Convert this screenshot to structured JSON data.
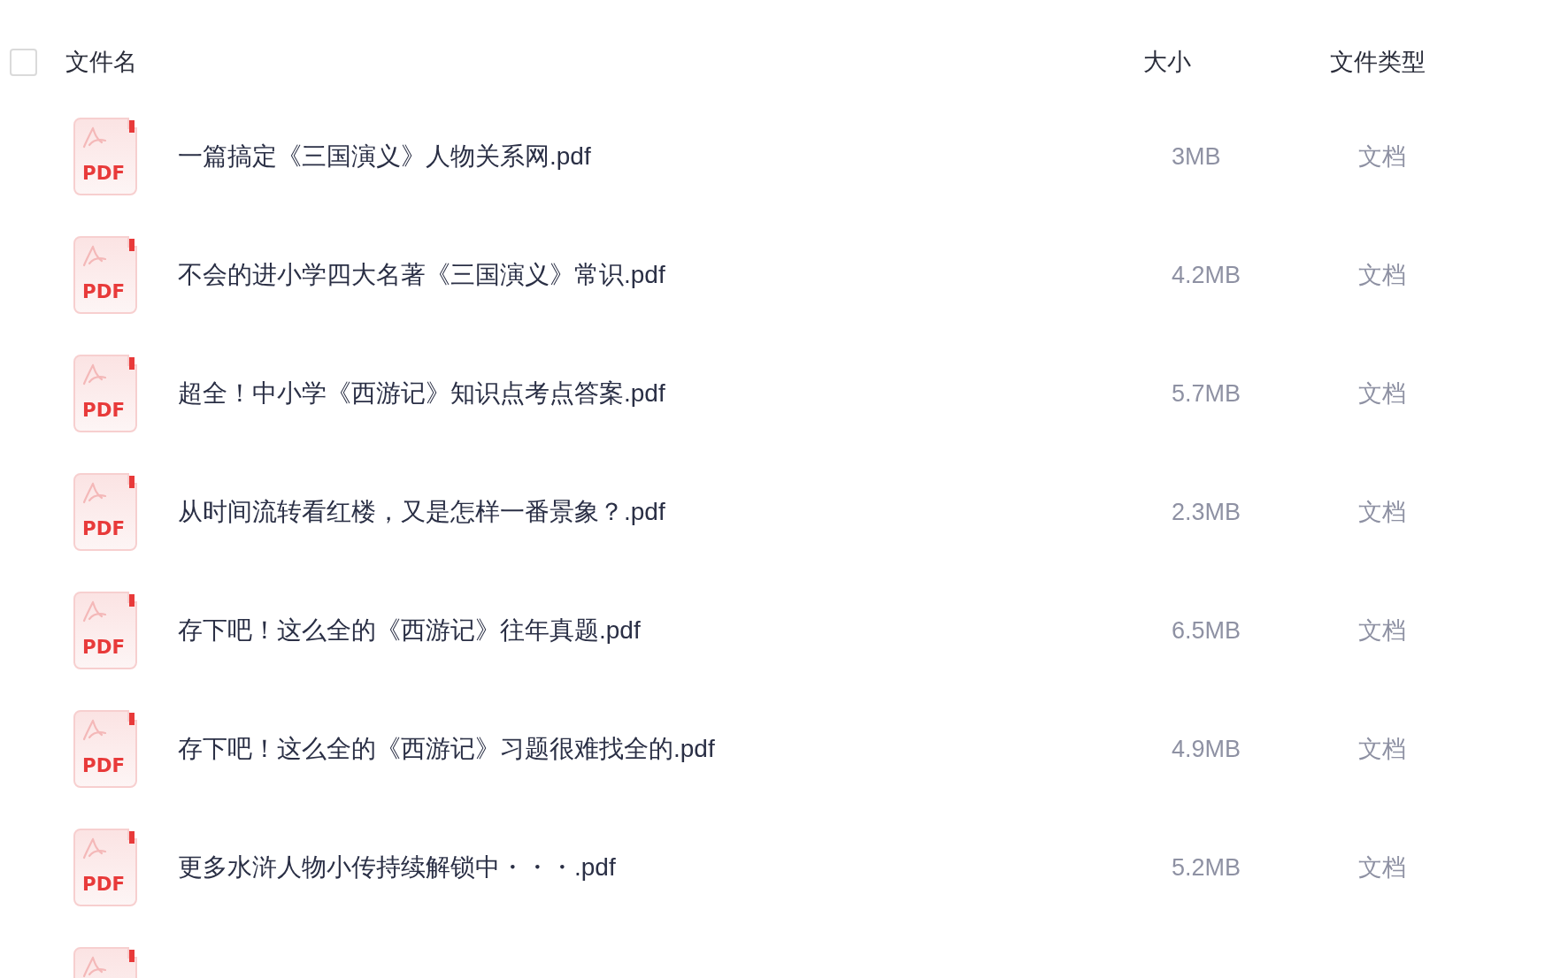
{
  "header": {
    "select_all": {
      "checked": false
    },
    "columns": [
      "文件名",
      "大小",
      "文件类型"
    ]
  },
  "rows": [
    {
      "kind": "file",
      "icon_text": "PDF",
      "name": "一篇搞定《三国演义》人物关系网.pdf",
      "size": "3MB",
      "type": "文档"
    },
    {
      "kind": "file",
      "icon_text": "PDF",
      "name": "不会的进小学四大名著《三国演义》常识.pdf",
      "size": "4.2MB",
      "type": "文档"
    },
    {
      "kind": "file",
      "icon_text": "PDF",
      "name": "超全！中小学《西游记》知识点考点答案.pdf",
      "size": "5.7MB",
      "type": "文档"
    },
    {
      "kind": "file",
      "icon_text": "PDF",
      "name": "从时间流转看红楼，又是怎样一番景象？.pdf",
      "size": "2.3MB",
      "type": "文档"
    },
    {
      "kind": "file",
      "icon_text": "PDF",
      "name": "存下吧！这么全的《西游记》往年真题.pdf",
      "size": "6.5MB",
      "type": "文档"
    },
    {
      "kind": "file",
      "icon_text": "PDF",
      "name": "存下吧！这么全的《西游记》习题很难找全的.pdf",
      "size": "4.9MB",
      "type": "文档"
    },
    {
      "kind": "file",
      "icon_text": "PDF",
      "name": "更多水浒人物小传持续解锁中・・・.pdf",
      "size": "5.2MB",
      "type": "文档"
    },
    {
      "kind": "cut"
    }
  ]
}
